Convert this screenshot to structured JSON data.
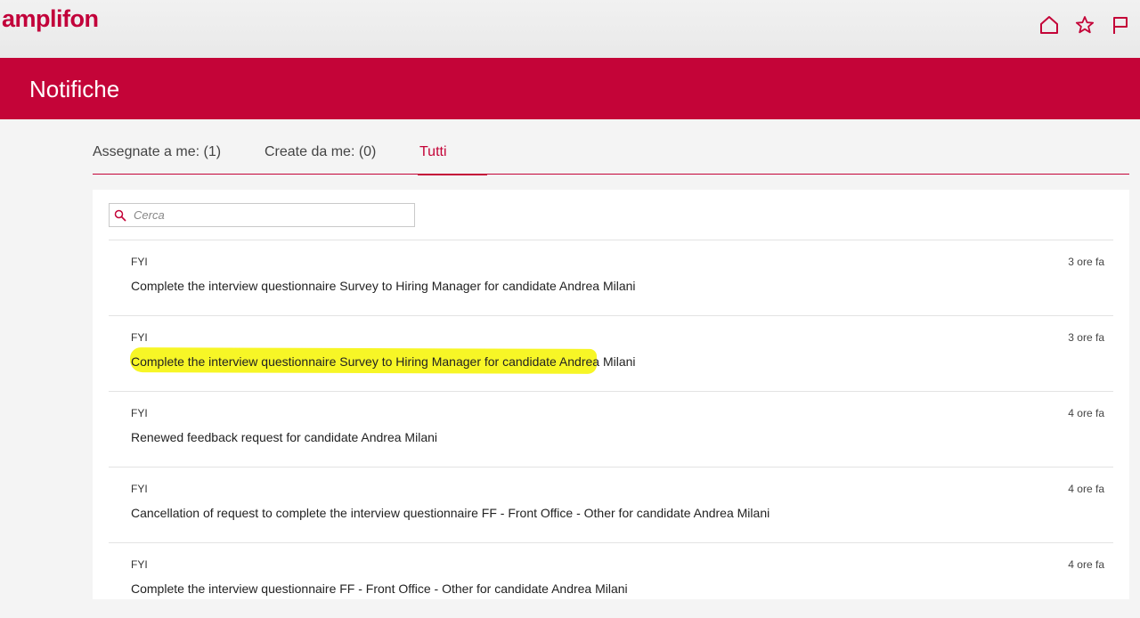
{
  "header": {
    "logo_text": "amplifon",
    "icons": [
      "home-icon",
      "star-icon",
      "flag-icon"
    ]
  },
  "banner": {
    "title": "Notifiche"
  },
  "tabs": [
    {
      "label": "Assegnate a me: (1)",
      "active": false
    },
    {
      "label": "Create da me: (0)",
      "active": false
    },
    {
      "label": "Tutti",
      "active": true
    }
  ],
  "search": {
    "placeholder": "Cerca",
    "value": ""
  },
  "notifications": [
    {
      "type": "FYI",
      "time": "3 ore fa",
      "message": "Complete the interview questionnaire Survey to Hiring Manager for candidate Andrea Milani"
    },
    {
      "type": "FYI",
      "time": "3 ore fa",
      "message": "Complete the interview questionnaire Survey to Hiring Manager for candidate Andrea Milani",
      "highlighted": true
    },
    {
      "type": "FYI",
      "time": "4 ore fa",
      "message": "Renewed feedback request for candidate Andrea Milani"
    },
    {
      "type": "FYI",
      "time": "4 ore fa",
      "message": "Cancellation of request to complete the interview questionnaire FF - Front Office - Other for candidate Andrea Milani"
    },
    {
      "type": "FYI",
      "time": "4 ore fa",
      "message": "Complete the interview questionnaire FF - Front Office - Other for candidate Andrea Milani"
    }
  ],
  "colors": {
    "brand": "#c40438",
    "highlight": "#f6f400"
  }
}
